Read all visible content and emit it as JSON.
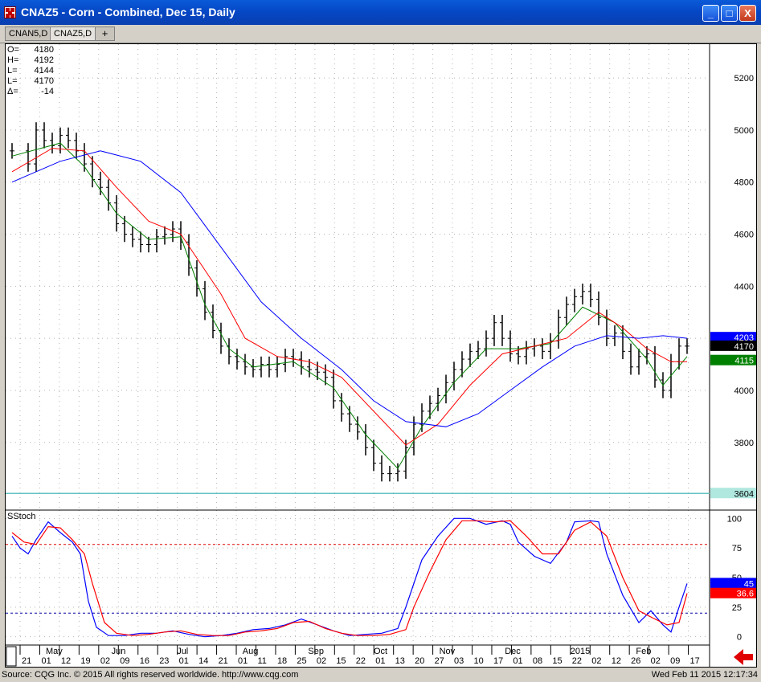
{
  "window": {
    "title": "CNAZ5 - Corn - Combined, Dec 15, Daily",
    "minimize_label": "_",
    "maximize_label": "□",
    "close_label": "X"
  },
  "tabs": [
    {
      "label": "CNAN5,D",
      "active": false
    },
    {
      "label": "CNAZ5,D",
      "active": true
    }
  ],
  "add_tab_label": "+",
  "ohlc": [
    {
      "key": "O=",
      "value": "4180"
    },
    {
      "key": "H=",
      "value": "4192"
    },
    {
      "key": "L=",
      "value": "4144"
    },
    {
      "key": "L=",
      "value": "4170"
    },
    {
      "key": "Δ=",
      "value": "-14"
    }
  ],
  "indicator_label": "SStoch",
  "price_markers": [
    {
      "value": "4203",
      "bg": "#0000ff",
      "fg": "#ffffff",
      "y": 4203
    },
    {
      "value": "4170",
      "bg": "#000000",
      "fg": "#ffffff",
      "y": 4170
    },
    {
      "value": "4115",
      "bg": "#008000",
      "fg": "#ffffff",
      "y": 4115
    },
    {
      "value": "3604",
      "bg": "#b0e8e0",
      "fg": "#000000",
      "y": 3604
    }
  ],
  "stoch_markers": [
    {
      "value": "45",
      "bg": "#0000ff",
      "fg": "#ffffff",
      "y": 45
    },
    {
      "value": "36.6",
      "bg": "#ff0000",
      "fg": "#ffffff",
      "y": 36.6
    }
  ],
  "footer": {
    "source": "Source: CQG Inc. © 2015 All rights reserved worldwide. http://www.cqg.com",
    "timestamp": "Wed Feb 11 2015 12:17:34"
  },
  "colors": {
    "ma_fast": "#008000",
    "ma_mid": "#ff0000",
    "ma_slow": "#0000ff",
    "stoch_k": "#0000ff",
    "stoch_d": "#ff0000",
    "bars": "#000000",
    "reference_line": "#66c2c2",
    "arrow": "#e00000"
  },
  "chart_data": [
    {
      "type": "ohlc",
      "y_axis_ticks": [
        3800,
        4000,
        4200,
        4400,
        4600,
        4800,
        5000,
        5200
      ],
      "ylim": [
        3540,
        5330
      ],
      "grid": true,
      "reference_line": 3604,
      "x_day_labels": [
        "21",
        "01",
        "12",
        "19",
        "02",
        "09",
        "16",
        "23",
        "01",
        "14",
        "21",
        "01",
        "11",
        "18",
        "25",
        "02",
        "15",
        "22",
        "01",
        "13",
        "20",
        "27",
        "03",
        "10",
        "17",
        "01",
        "08",
        "15",
        "22",
        "02",
        "12",
        "26",
        "02",
        "09",
        "17"
      ],
      "x_month_labels": [
        "May",
        "Jun",
        "Jul",
        "Aug",
        "Sep",
        "Oct",
        "Nov",
        "Dec",
        "2015",
        "Feb"
      ],
      "series": [
        {
          "name": "price",
          "points": [
            [
              0,
              4920
            ],
            [
              20,
              4870
            ],
            [
              30,
              5000
            ],
            [
              40,
              4960
            ],
            [
              50,
              4940
            ],
            [
              60,
              4980
            ],
            [
              70,
              4960
            ],
            [
              80,
              4920
            ],
            [
              90,
              4870
            ],
            [
              100,
              4810
            ],
            [
              110,
              4780
            ],
            [
              120,
              4720
            ],
            [
              130,
              4640
            ],
            [
              140,
              4600
            ],
            [
              150,
              4580
            ],
            [
              160,
              4560
            ],
            [
              170,
              4560
            ],
            [
              180,
              4590
            ],
            [
              190,
              4600
            ],
            [
              200,
              4620
            ],
            [
              210,
              4570
            ],
            [
              220,
              4470
            ],
            [
              230,
              4390
            ],
            [
              240,
              4300
            ],
            [
              250,
              4230
            ],
            [
              260,
              4170
            ],
            [
              270,
              4130
            ],
            [
              280,
              4110
            ],
            [
              290,
              4090
            ],
            [
              300,
              4080
            ],
            [
              310,
              4100
            ],
            [
              320,
              4080
            ],
            [
              330,
              4100
            ],
            [
              340,
              4130
            ],
            [
              350,
              4120
            ],
            [
              360,
              4090
            ],
            [
              370,
              4080
            ],
            [
              380,
              4070
            ],
            [
              390,
              4050
            ],
            [
              400,
              3960
            ],
            [
              410,
              3910
            ],
            [
              420,
              3870
            ],
            [
              430,
              3840
            ],
            [
              440,
              3780
            ],
            [
              450,
              3720
            ],
            [
              460,
              3680
            ],
            [
              470,
              3680
            ],
            [
              480,
              3690
            ],
            [
              490,
              3780
            ],
            [
              500,
              3870
            ],
            [
              510,
              3920
            ],
            [
              520,
              3950
            ],
            [
              530,
              3980
            ],
            [
              540,
              4030
            ],
            [
              550,
              4080
            ],
            [
              560,
              4120
            ],
            [
              570,
              4150
            ],
            [
              580,
              4160
            ],
            [
              590,
              4200
            ],
            [
              600,
              4260
            ],
            [
              610,
              4200
            ],
            [
              620,
              4140
            ],
            [
              630,
              4130
            ],
            [
              640,
              4160
            ],
            [
              650,
              4170
            ],
            [
              660,
              4150
            ],
            [
              670,
              4190
            ],
            [
              680,
              4280
            ],
            [
              690,
              4330
            ],
            [
              700,
              4360
            ],
            [
              710,
              4380
            ],
            [
              720,
              4350
            ],
            [
              730,
              4280
            ],
            [
              740,
              4200
            ],
            [
              750,
              4220
            ],
            [
              760,
              4150
            ],
            [
              770,
              4090
            ],
            [
              780,
              4130
            ],
            [
              790,
              4140
            ],
            [
              800,
              4040
            ],
            [
              810,
              4000
            ],
            [
              820,
              4110
            ],
            [
              830,
              4170
            ],
            [
              840,
              4170
            ]
          ]
        },
        {
          "name": "fast_ma",
          "points": [
            [
              0,
              4900
            ],
            [
              60,
              4950
            ],
            [
              90,
              4860
            ],
            [
              130,
              4680
            ],
            [
              170,
              4580
            ],
            [
              210,
              4590
            ],
            [
              240,
              4330
            ],
            [
              270,
              4160
            ],
            [
              300,
              4090
            ],
            [
              350,
              4110
            ],
            [
              400,
              4010
            ],
            [
              440,
              3830
            ],
            [
              480,
              3700
            ],
            [
              510,
              3860
            ],
            [
              550,
              4030
            ],
            [
              590,
              4160
            ],
            [
              630,
              4160
            ],
            [
              670,
              4180
            ],
            [
              710,
              4320
            ],
            [
              750,
              4260
            ],
            [
              790,
              4120
            ],
            [
              810,
              4020
            ],
            [
              840,
              4130
            ]
          ]
        },
        {
          "name": "mid_ma",
          "points": [
            [
              0,
              4840
            ],
            [
              50,
              4930
            ],
            [
              90,
              4920
            ],
            [
              130,
              4780
            ],
            [
              170,
              4650
            ],
            [
              210,
              4600
            ],
            [
              260,
              4370
            ],
            [
              290,
              4200
            ],
            [
              330,
              4130
            ],
            [
              370,
              4110
            ],
            [
              410,
              4050
            ],
            [
              450,
              3920
            ],
            [
              490,
              3790
            ],
            [
              530,
              3870
            ],
            [
              570,
              4020
            ],
            [
              610,
              4140
            ],
            [
              650,
              4170
            ],
            [
              690,
              4200
            ],
            [
              730,
              4300
            ],
            [
              760,
              4240
            ],
            [
              790,
              4160
            ],
            [
              820,
              4110
            ],
            [
              840,
              4110
            ]
          ]
        },
        {
          "name": "slow_ma",
          "points": [
            [
              0,
              4800
            ],
            [
              60,
              4880
            ],
            [
              110,
              4920
            ],
            [
              160,
              4880
            ],
            [
              210,
              4760
            ],
            [
              260,
              4550
            ],
            [
              310,
              4340
            ],
            [
              360,
              4200
            ],
            [
              410,
              4080
            ],
            [
              450,
              3960
            ],
            [
              490,
              3880
            ],
            [
              540,
              3860
            ],
            [
              580,
              3910
            ],
            [
              620,
              4000
            ],
            [
              660,
              4090
            ],
            [
              700,
              4170
            ],
            [
              740,
              4210
            ],
            [
              780,
              4200
            ],
            [
              810,
              4210
            ],
            [
              840,
              4200
            ]
          ]
        }
      ]
    },
    {
      "type": "line",
      "title": "SStoch",
      "y_axis_ticks": [
        0,
        25,
        50,
        75,
        100
      ],
      "ylim": [
        -7,
        107
      ],
      "reference_lines": [
        78,
        20
      ],
      "series": [
        {
          "name": "k",
          "points": [
            [
              0,
              85
            ],
            [
              10,
              75
            ],
            [
              20,
              70
            ],
            [
              30,
              82
            ],
            [
              45,
              97
            ],
            [
              60,
              88
            ],
            [
              75,
              80
            ],
            [
              85,
              70
            ],
            [
              95,
              30
            ],
            [
              105,
              8
            ],
            [
              120,
              1
            ],
            [
              140,
              1
            ],
            [
              160,
              3
            ],
            [
              180,
              3
            ],
            [
              200,
              5
            ],
            [
              220,
              2
            ],
            [
              240,
              0
            ],
            [
              260,
              1
            ],
            [
              280,
              3
            ],
            [
              300,
              6
            ],
            [
              320,
              7
            ],
            [
              340,
              10
            ],
            [
              360,
              15
            ],
            [
              380,
              10
            ],
            [
              400,
              5
            ],
            [
              420,
              1
            ],
            [
              440,
              2
            ],
            [
              460,
              3
            ],
            [
              480,
              7
            ],
            [
              490,
              25
            ],
            [
              510,
              65
            ],
            [
              530,
              85
            ],
            [
              550,
              100
            ],
            [
              570,
              100
            ],
            [
              590,
              95
            ],
            [
              610,
              98
            ],
            [
              620,
              95
            ],
            [
              630,
              80
            ],
            [
              650,
              68
            ],
            [
              670,
              62
            ],
            [
              690,
              80
            ],
            [
              700,
              97
            ],
            [
              720,
              98
            ],
            [
              730,
              97
            ],
            [
              740,
              70
            ],
            [
              760,
              35
            ],
            [
              780,
              12
            ],
            [
              795,
              22
            ],
            [
              810,
              10
            ],
            [
              820,
              4
            ],
            [
              830,
              25
            ],
            [
              840,
              45
            ]
          ]
        },
        {
          "name": "d",
          "points": [
            [
              0,
              88
            ],
            [
              15,
              80
            ],
            [
              30,
              78
            ],
            [
              45,
              93
            ],
            [
              60,
              92
            ],
            [
              75,
              82
            ],
            [
              90,
              70
            ],
            [
              100,
              45
            ],
            [
              115,
              12
            ],
            [
              130,
              3
            ],
            [
              150,
              1
            ],
            [
              170,
              2
            ],
            [
              190,
              4
            ],
            [
              210,
              5
            ],
            [
              230,
              2
            ],
            [
              250,
              1
            ],
            [
              270,
              1
            ],
            [
              290,
              4
            ],
            [
              310,
              5
            ],
            [
              330,
              7
            ],
            [
              350,
              12
            ],
            [
              370,
              13
            ],
            [
              390,
              7
            ],
            [
              410,
              3
            ],
            [
              430,
              1
            ],
            [
              450,
              1
            ],
            [
              470,
              2
            ],
            [
              490,
              6
            ],
            [
              500,
              25
            ],
            [
              520,
              55
            ],
            [
              540,
              82
            ],
            [
              560,
              98
            ],
            [
              580,
              98
            ],
            [
              600,
              97
            ],
            [
              620,
              98
            ],
            [
              640,
              85
            ],
            [
              660,
              70
            ],
            [
              680,
              70
            ],
            [
              700,
              90
            ],
            [
              720,
              97
            ],
            [
              740,
              85
            ],
            [
              760,
              50
            ],
            [
              780,
              22
            ],
            [
              800,
              15
            ],
            [
              815,
              10
            ],
            [
              830,
              12
            ],
            [
              840,
              36.6
            ]
          ]
        }
      ]
    }
  ]
}
